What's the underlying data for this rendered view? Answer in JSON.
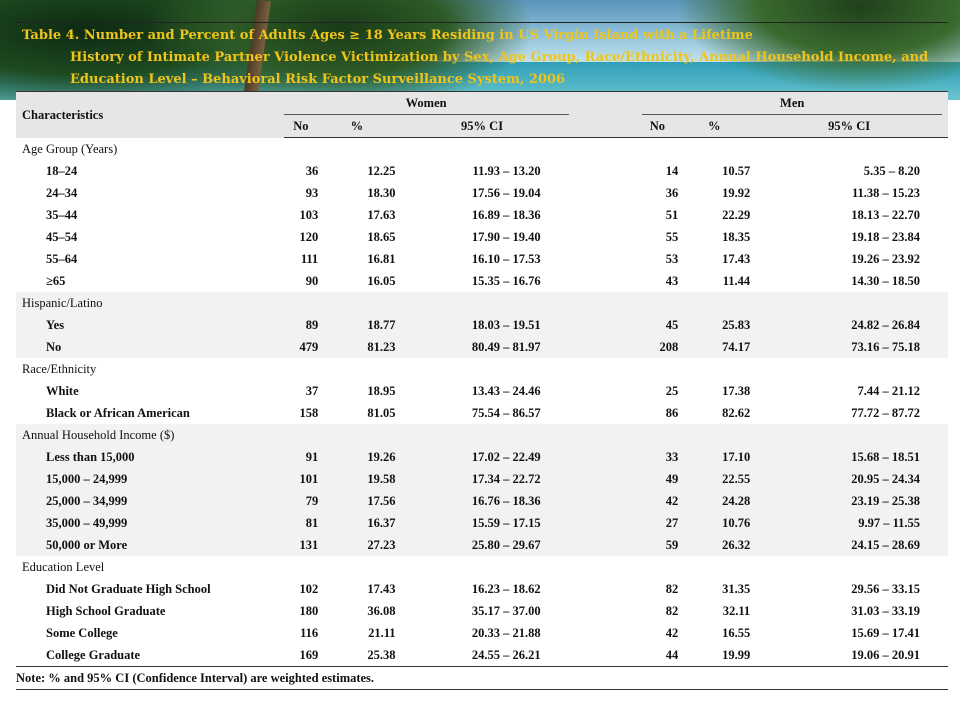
{
  "title": {
    "line1": "Table 4. Number and Percent of Adults Ages ≥ 18 Years Residing in US Virgin Island with a Lifetime",
    "line2": "History of Intimate Partner Violence Victimization by Sex, Age Group, Race/Ethnicity, Annual Household Income, and",
    "line3": "Education Level – Behavioral Risk Factor Surveillance System, 2006"
  },
  "header": {
    "characteristics": "Characteristics",
    "women": "Women",
    "men": "Men",
    "no": "No",
    "pct": "%",
    "ci": "95% CI"
  },
  "groups": [
    {
      "label": "Age Group (Years)",
      "rows": [
        {
          "label": "18–24",
          "w_no": "36",
          "w_pct": "12.25",
          "w_ci": "11.93 – 13.20",
          "m_no": "14",
          "m_pct": "10.57",
          "m_ci": "5.35 – 8.20"
        },
        {
          "label": "24–34",
          "w_no": "93",
          "w_pct": "18.30",
          "w_ci": "17.56 – 19.04",
          "m_no": "36",
          "m_pct": "19.92",
          "m_ci": "11.38 – 15.23"
        },
        {
          "label": "35–44",
          "w_no": "103",
          "w_pct": "17.63",
          "w_ci": "16.89 – 18.36",
          "m_no": "51",
          "m_pct": "22.29",
          "m_ci": "18.13 – 22.70"
        },
        {
          "label": "45–54",
          "w_no": "120",
          "w_pct": "18.65",
          "w_ci": "17.90 – 19.40",
          "m_no": "55",
          "m_pct": "18.35",
          "m_ci": "19.18 – 23.84"
        },
        {
          "label": "55–64",
          "w_no": "111",
          "w_pct": "16.81",
          "w_ci": "16.10 – 17.53",
          "m_no": "53",
          "m_pct": "17.43",
          "m_ci": "19.26 – 23.92"
        },
        {
          "label": "≥65",
          "w_no": "90",
          "w_pct": "16.05",
          "w_ci": "15.35 – 16.76",
          "m_no": "43",
          "m_pct": "11.44",
          "m_ci": "14.30 – 18.50"
        }
      ]
    },
    {
      "label": "Hispanic/Latino",
      "rows": [
        {
          "label": "Yes",
          "w_no": "89",
          "w_pct": "18.77",
          "w_ci": "18.03 – 19.51",
          "m_no": "45",
          "m_pct": "25.83",
          "m_ci": "24.82 – 26.84"
        },
        {
          "label": "No",
          "w_no": "479",
          "w_pct": "81.23",
          "w_ci": "80.49 – 81.97",
          "m_no": "208",
          "m_pct": "74.17",
          "m_ci": "73.16 – 75.18"
        }
      ]
    },
    {
      "label": "Race/Ethnicity",
      "rows": [
        {
          "label": "White",
          "w_no": "37",
          "w_pct": "18.95",
          "w_ci": "13.43 – 24.46",
          "m_no": "25",
          "m_pct": "17.38",
          "m_ci": "7.44 – 21.12"
        },
        {
          "label": "Black or African American",
          "w_no": "158",
          "w_pct": "81.05",
          "w_ci": "75.54 – 86.57",
          "m_no": "86",
          "m_pct": "82.62",
          "m_ci": "77.72 – 87.72"
        }
      ]
    },
    {
      "label": "Annual Household Income ($)",
      "rows": [
        {
          "label": "Less than 15,000",
          "w_no": "91",
          "w_pct": "19.26",
          "w_ci": "17.02 – 22.49",
          "m_no": "33",
          "m_pct": "17.10",
          "m_ci": "15.68 – 18.51"
        },
        {
          "label": "15,000 – 24,999",
          "w_no": "101",
          "w_pct": "19.58",
          "w_ci": "17.34 – 22.72",
          "m_no": "49",
          "m_pct": "22.55",
          "m_ci": "20.95 – 24.34"
        },
        {
          "label": "25,000 – 34,999",
          "w_no": "79",
          "w_pct": "17.56",
          "w_ci": "16.76 – 18.36",
          "m_no": "42",
          "m_pct": "24.28",
          "m_ci": "23.19 – 25.38"
        },
        {
          "label": "35,000 – 49,999",
          "w_no": "81",
          "w_pct": "16.37",
          "w_ci": "15.59 – 17.15",
          "m_no": "27",
          "m_pct": "10.76",
          "m_ci": "9.97 – 11.55"
        },
        {
          "label": "50,000 or More",
          "w_no": "131",
          "w_pct": "27.23",
          "w_ci": "25.80 – 29.67",
          "m_no": "59",
          "m_pct": "26.32",
          "m_ci": "24.15 – 28.69"
        }
      ]
    },
    {
      "label": "Education Level",
      "rows": [
        {
          "label": "Did Not Graduate High School",
          "w_no": "102",
          "w_pct": "17.43",
          "w_ci": "16.23 – 18.62",
          "m_no": "82",
          "m_pct": "31.35",
          "m_ci": "29.56 – 33.15"
        },
        {
          "label": "High School Graduate",
          "w_no": "180",
          "w_pct": "36.08",
          "w_ci": "35.17 – 37.00",
          "m_no": "82",
          "m_pct": "32.11",
          "m_ci": "31.03 – 33.19"
        },
        {
          "label": "Some College",
          "w_no": "116",
          "w_pct": "21.11",
          "w_ci": "20.33 – 21.88",
          "m_no": "42",
          "m_pct": "16.55",
          "m_ci": "15.69 – 17.41"
        },
        {
          "label": "College Graduate",
          "w_no": "169",
          "w_pct": "25.38",
          "w_ci": "24.55 – 26.21",
          "m_no": "44",
          "m_pct": "19.99",
          "m_ci": "19.06 – 20.91"
        }
      ]
    }
  ],
  "note": "Note:  % and 95% CI (Confidence Interval) are weighted estimates.",
  "colors": {
    "title": "#f0c419",
    "header_bg": "#e6e6e6",
    "shade_bg": "#f2f2f2"
  }
}
